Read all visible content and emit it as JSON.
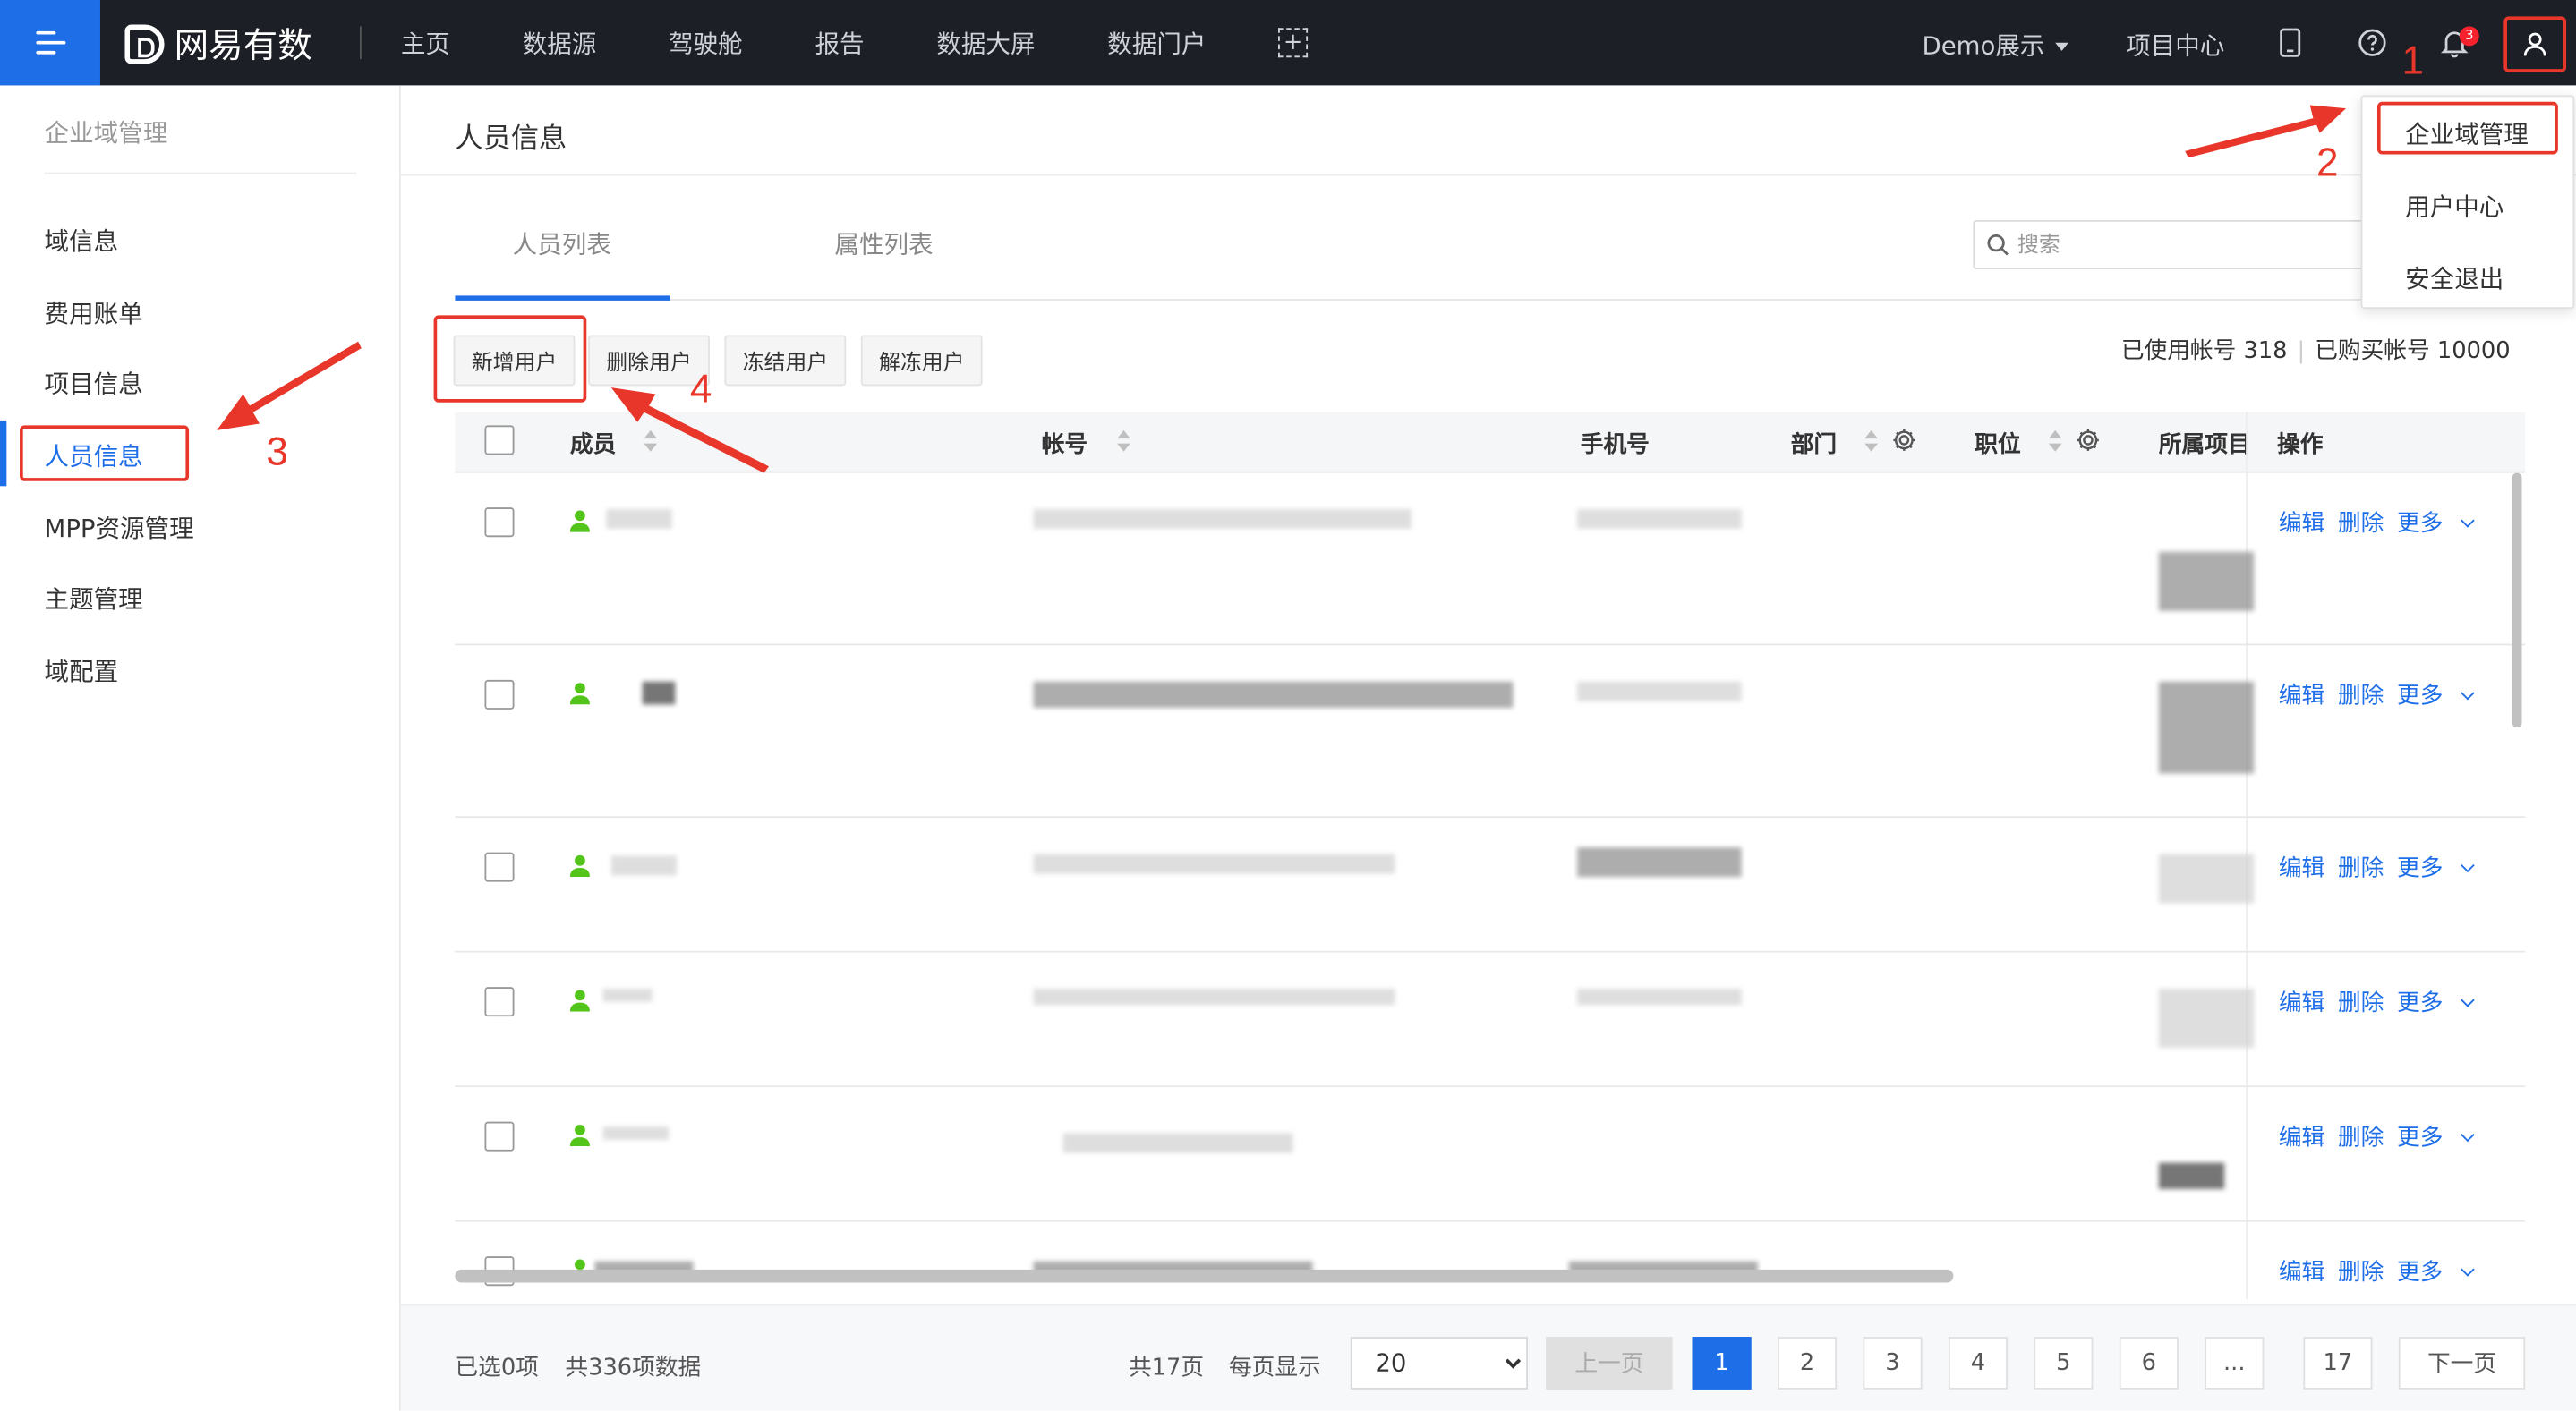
{
  "topbar": {
    "brand": "网易有数",
    "nav": [
      "主页",
      "数据源",
      "驾驶舱",
      "报告",
      "数据大屏",
      "数据门户"
    ],
    "add_symbol": "+",
    "project_selector": "Demo展示",
    "project_center": "项目中心",
    "notification_count": "3"
  },
  "sidebar": {
    "title": "企业域管理",
    "items": [
      "域信息",
      "费用账单",
      "项目信息",
      "人员信息",
      "MPP资源管理",
      "主题管理",
      "域配置"
    ],
    "active_index": 3
  },
  "main": {
    "page_title": "人员信息",
    "tabs": [
      "人员列表",
      "属性列表"
    ],
    "search_placeholder": "搜索",
    "buttons": {
      "add": "新增用户",
      "delete": "删除用户",
      "freeze": "冻结用户",
      "unfreeze": "解冻用户"
    },
    "account_used": "已使用帐号 318",
    "account_purchased": "已购买帐号 10000",
    "columns": {
      "member": "成员",
      "account": "帐号",
      "phone": "手机号",
      "department": "部门",
      "position": "职位",
      "project": "所属项目",
      "actions": "操作"
    },
    "row_actions": {
      "edit": "编辑",
      "delete": "删除",
      "more": "更多"
    }
  },
  "footer": {
    "selected": "已选0项",
    "total": "共336项数据",
    "total_pages": "共17页",
    "per_page_label": "每页显示",
    "per_page_value": "20",
    "prev": "上一页",
    "pages": [
      "1",
      "2",
      "3",
      "4",
      "5",
      "6",
      "...",
      "17"
    ],
    "current_page": "1",
    "next": "下一页"
  },
  "user_menu": {
    "items": [
      "企业域管理",
      "用户中心",
      "安全退出"
    ]
  },
  "annotations": [
    "1",
    "2",
    "3",
    "4"
  ],
  "colors": {
    "topbar_bg": "#1d1f26",
    "accent": "#1e6ee8",
    "annotation_red": "#e8372a",
    "user_green": "#52c41a"
  }
}
